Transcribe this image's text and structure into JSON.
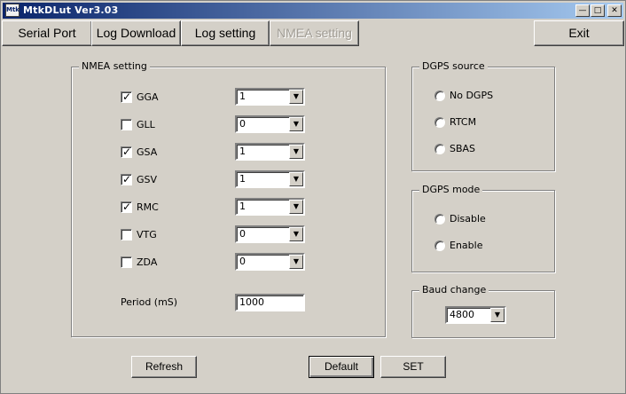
{
  "window": {
    "title": "MtkDLut Ver3.03",
    "icon": "MtkDLut-app-icon",
    "controls": [
      "minimize-icon",
      "maximize-icon",
      "close-icon"
    ]
  },
  "tabs": [
    {
      "label": "Serial Port",
      "enabled": true
    },
    {
      "label": "Log Download",
      "enabled": true
    },
    {
      "label": "Log setting",
      "enabled": true
    },
    {
      "label": "NMEA setting",
      "enabled": false
    }
  ],
  "exit_label": "Exit",
  "nmea": {
    "group_label": "NMEA setting",
    "sentences": [
      {
        "name": "GGA",
        "checked": true,
        "rate": "1"
      },
      {
        "name": "GLL",
        "checked": false,
        "rate": "0"
      },
      {
        "name": "GSA",
        "checked": true,
        "rate": "1"
      },
      {
        "name": "GSV",
        "checked": true,
        "rate": "1"
      },
      {
        "name": "RMC",
        "checked": true,
        "rate": "1"
      },
      {
        "name": "VTG",
        "checked": false,
        "rate": "0"
      },
      {
        "name": "ZDA",
        "checked": false,
        "rate": "0"
      }
    ],
    "period_label": "Period (mS)",
    "period_value": "1000"
  },
  "dgps_source": {
    "group_label": "DGPS source",
    "options": [
      "No DGPS",
      "RTCM",
      "SBAS"
    ]
  },
  "dgps_mode": {
    "group_label": "DGPS mode",
    "options": [
      "Disable",
      "Enable"
    ]
  },
  "baud": {
    "group_label": "Baud change",
    "value": "4800"
  },
  "buttons": {
    "refresh": "Refresh",
    "default": "Default",
    "set": "SET"
  },
  "colors": {
    "face": "#d4d0c8",
    "title_start": "#0a246a",
    "title_end": "#a6caf0",
    "disabled_text": "#a09c94"
  }
}
